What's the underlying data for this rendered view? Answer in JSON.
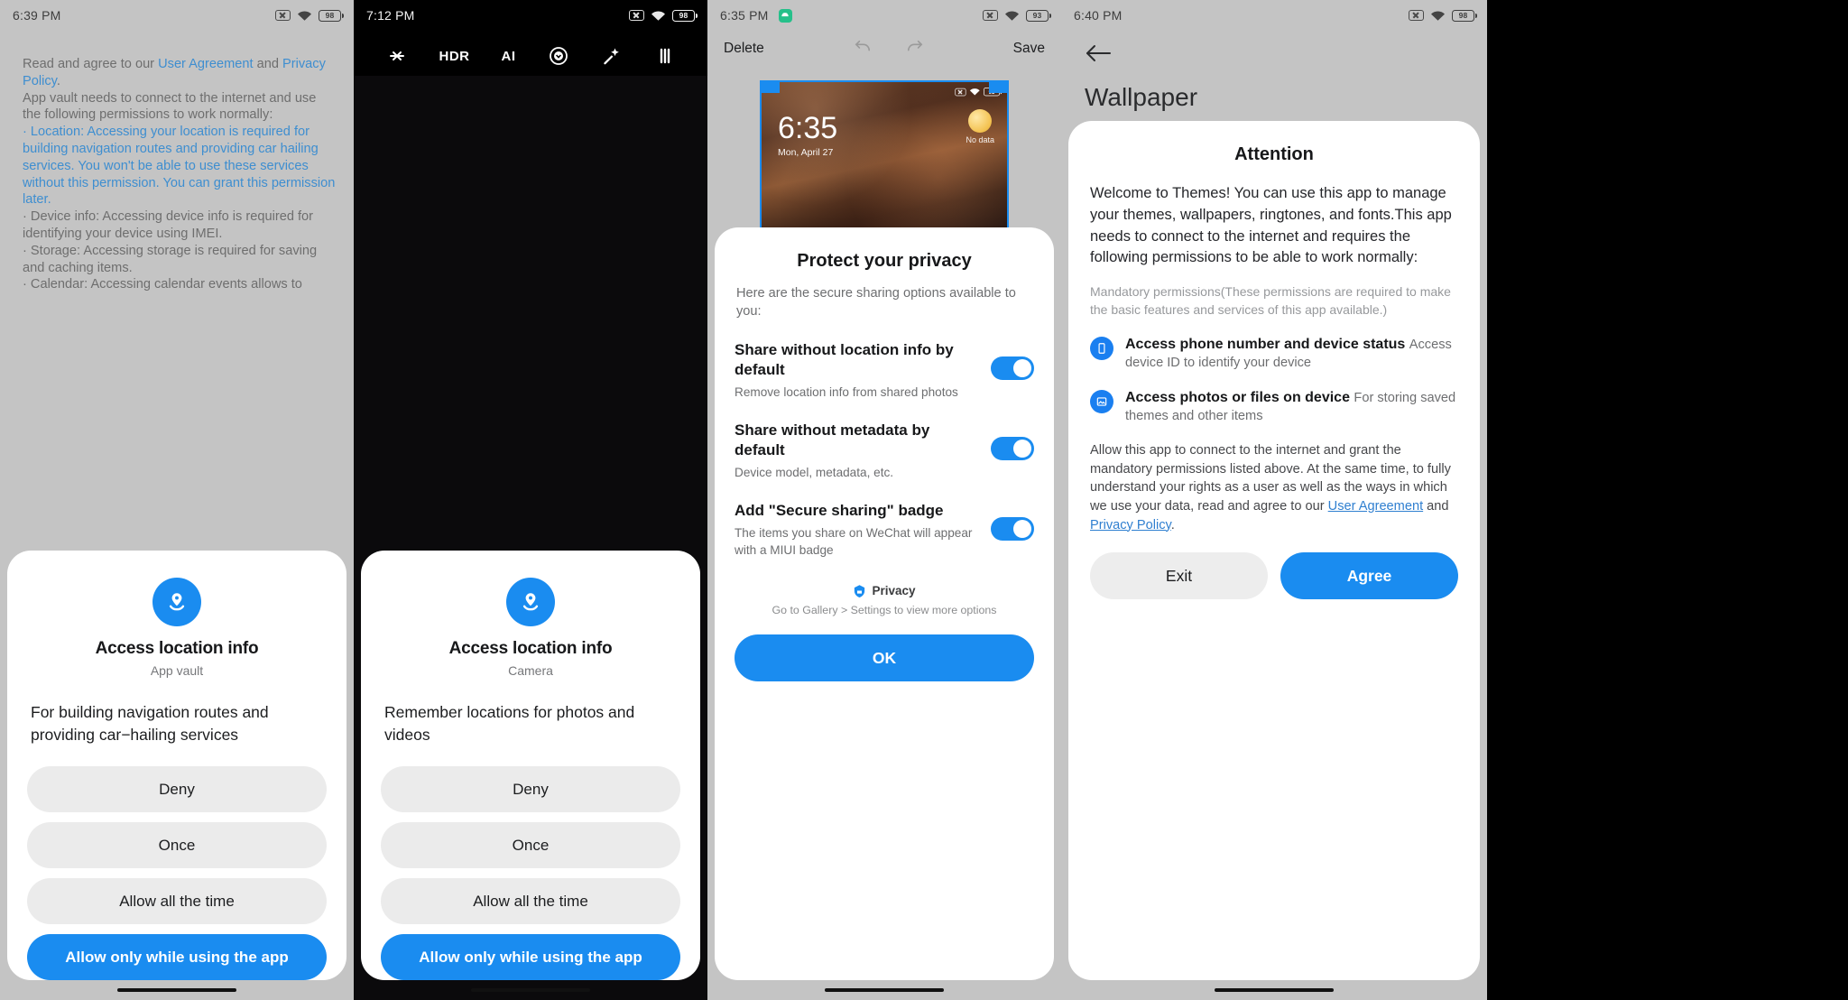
{
  "panel1": {
    "status": {
      "time": "6:39 PM",
      "battery": "98",
      "icons": [
        "no-sim-icon",
        "wifi-icon",
        "battery-icon"
      ]
    },
    "agreement": {
      "line_intro_a": "Read and agree to our ",
      "link_user_agreement": "User Agreement",
      "line_intro_b": " and ",
      "link_privacy_policy": "Privacy Policy",
      "line_intro_c": ".",
      "paragraph2": "App vault needs to connect to the internet and use the following permissions to work normally:",
      "bullet_location": " · Location: Accessing your location is required for building navigation routes and providing car hailing services. You won't be able to use these services without this permission. You can grant this permission later.",
      "bullet_device": " · Device info: Accessing device info is required for identifying your device using IMEI.",
      "bullet_storage": " · Storage: Accessing storage is required for saving and caching items.",
      "bullet_calendar": " · Calendar: Accessing calendar events allows to"
    },
    "sheet": {
      "icon": "location-pin-icon",
      "title": "Access location info",
      "subtitle": "App vault",
      "description": "For building navigation routes and providing car−hailing services",
      "buttons": [
        "Deny",
        "Once",
        "Allow all the time",
        "Allow only while using the app"
      ]
    }
  },
  "panel2": {
    "status": {
      "time": "7:12 PM",
      "battery": "98",
      "icons": [
        "no-sim-icon",
        "wifi-icon",
        "battery-icon"
      ]
    },
    "toolbar": [
      {
        "name": "flash-off-icon",
        "label": ""
      },
      {
        "name": "hdr-icon",
        "label": "HDR"
      },
      {
        "name": "ai-icon",
        "label": "AI"
      },
      {
        "name": "filter-circle-icon",
        "label": ""
      },
      {
        "name": "magic-wand-icon",
        "label": ""
      },
      {
        "name": "more-options-icon",
        "label": ""
      }
    ],
    "sheet": {
      "icon": "location-pin-icon",
      "title": "Access location info",
      "subtitle": "Camera",
      "description": "Remember locations for photos and videos",
      "buttons": [
        "Deny",
        "Once",
        "Allow all the time",
        "Allow only while using the app"
      ]
    }
  },
  "panel3": {
    "status": {
      "time": "6:35 PM",
      "battery": "93",
      "icons": [
        "android-badge-icon",
        "no-sim-icon",
        "wifi-icon",
        "battery-icon"
      ]
    },
    "editor": {
      "delete": "Delete",
      "undo": "undo-icon",
      "redo": "redo-icon",
      "save": "Save"
    },
    "preview": {
      "time": "6:35",
      "date": "Mon, April 27",
      "weather": "No data"
    },
    "privacy": {
      "title": "Protect your privacy",
      "lead": "Here are the secure sharing options available to you:",
      "rows": [
        {
          "title": "Share without location info by default",
          "sub": "Remove location info from shared photos",
          "on": true
        },
        {
          "title": "Share without metadata by default",
          "sub": "Device model, metadata, etc.",
          "on": true
        },
        {
          "title": "Add \"Secure sharing\" badge",
          "sub": "The items you share on WeChat will appear with a MIUI badge",
          "on": true
        }
      ],
      "brand": "Privacy",
      "footer": "Go to Gallery > Settings to view more options",
      "ok": "OK"
    }
  },
  "panel4": {
    "status": {
      "time": "6:40 PM",
      "battery": "98",
      "icons": [
        "no-sim-icon",
        "wifi-icon",
        "battery-icon"
      ]
    },
    "back": "back-arrow-icon",
    "heading": "Wallpaper",
    "attention": {
      "title": "Attention",
      "body": "Welcome to Themes! You can use this app to manage your themes, wallpapers, ringtones, and fonts.This app needs to connect to the internet and requires the following permissions to be able to work normally:",
      "note": "Mandatory permissions(These permissions are required to make the basic features and services of this app available.)",
      "permissions": [
        {
          "icon": "phone-status-icon",
          "title": "Access phone number and device status",
          "sub": "Access device ID to identify your device"
        },
        {
          "icon": "photos-files-icon",
          "title": "Access photos or files on device",
          "sub": "For storing saved themes and other items"
        }
      ],
      "tail_a": "Allow this app to connect to the internet and grant the mandatory permissions listed above. At the same time, to fully understand your rights as a user as well as the ways in which we use your data, read and agree to our ",
      "link_user_agreement": "User Agreement",
      "tail_b": " and ",
      "link_privacy_policy": "Privacy Policy",
      "tail_c": ".",
      "exit": "Exit",
      "agree": "Agree"
    }
  },
  "colors": {
    "accent": "#1a8cf0",
    "link": "#3e8ed0",
    "sheet_bg": "#ffffff",
    "page_bg": "#c4c4c4"
  }
}
